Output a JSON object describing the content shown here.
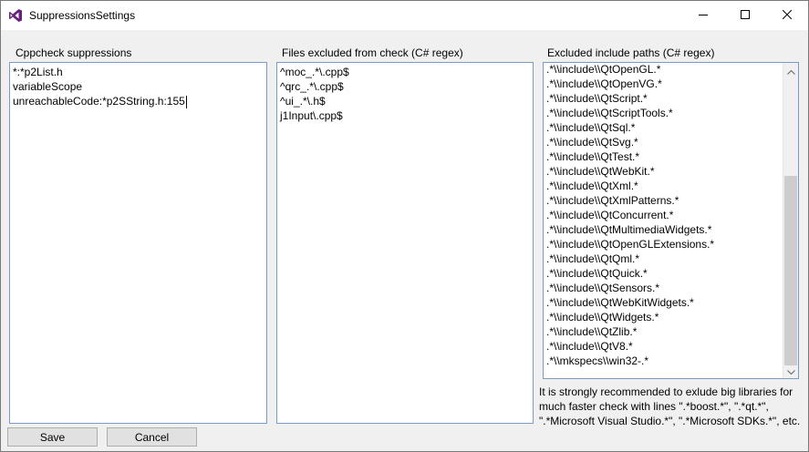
{
  "window": {
    "title": "SuppressionsSettings",
    "icons": {
      "app": "visual-studio-icon",
      "minimize": "minimize-icon",
      "maximize": "maximize-icon",
      "close": "close-icon"
    }
  },
  "panels": {
    "suppressions": {
      "label": "Cppcheck suppressions",
      "lines": [
        "*:*p2List.h",
        "variableScope",
        "unreachableCode:*p2SString.h:155"
      ]
    },
    "files_excluded": {
      "label": "Files excluded from check (C# regex)",
      "lines": [
        "^moc_.*\\.cpp$",
        "^qrc_.*\\.cpp$",
        "^ui_.*\\.h$",
        "j1Input\\.cpp$"
      ]
    },
    "include_paths": {
      "label": "Excluded include paths (C# regex)",
      "lines": [
        ".*\\\\include\\\\QtOpenGL.*",
        ".*\\\\include\\\\QtOpenVG.*",
        ".*\\\\include\\\\QtScript.*",
        ".*\\\\include\\\\QtScriptTools.*",
        ".*\\\\include\\\\QtSql.*",
        ".*\\\\include\\\\QtSvg.*",
        ".*\\\\include\\\\QtTest.*",
        ".*\\\\include\\\\QtWebKit.*",
        ".*\\\\include\\\\QtXml.*",
        ".*\\\\include\\\\QtXmlPatterns.*",
        ".*\\\\include\\\\QtConcurrent.*",
        ".*\\\\include\\\\QtMultimediaWidgets.*",
        ".*\\\\include\\\\QtOpenGLExtensions.*",
        ".*\\\\include\\\\QtQml.*",
        ".*\\\\include\\\\QtQuick.*",
        ".*\\\\include\\\\QtSensors.*",
        ".*\\\\include\\\\QtWebKitWidgets.*",
        ".*\\\\include\\\\QtWidgets.*",
        ".*\\\\include\\\\QtZlib.*",
        ".*\\\\include\\\\QtV8.*",
        ".*\\\\mkspecs\\\\win32-.*"
      ]
    }
  },
  "note": {
    "line1": "It is strongly recommended to exlude big libraries for",
    "line2": "much faster check with lines \".*boost.*\", \".*qt.*\",",
    "line3": "\".*Microsoft Visual Studio.*\", \".*Microsoft SDKs.*\", etc."
  },
  "buttons": {
    "save": "Save",
    "cancel": "Cancel"
  },
  "colors": {
    "accent": "#68217a",
    "border": "#7a9bc4"
  }
}
